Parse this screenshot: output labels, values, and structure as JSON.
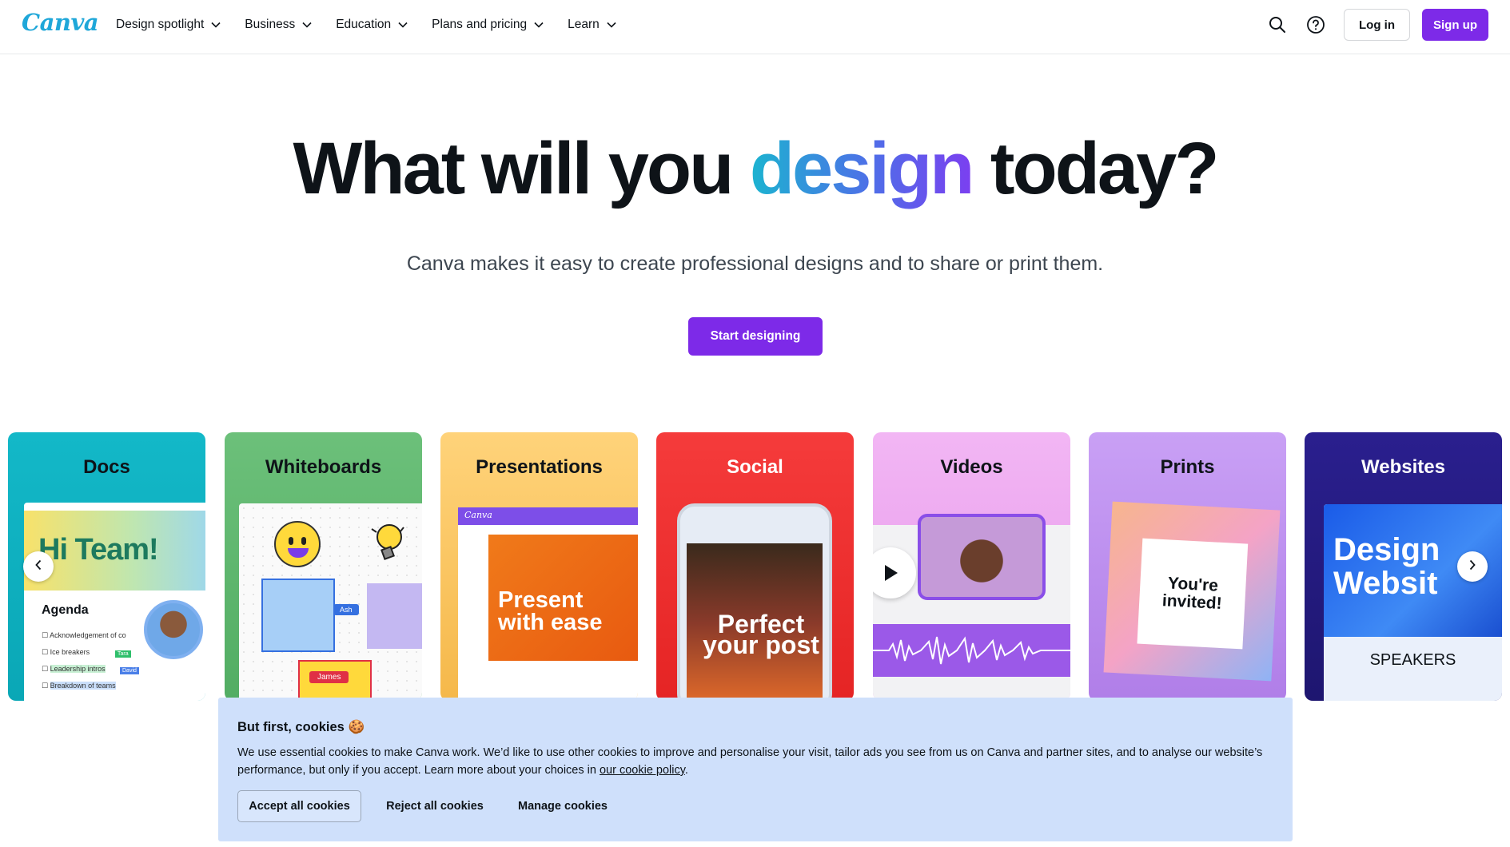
{
  "header": {
    "logo": "Canva",
    "nav": [
      {
        "label": "Design spotlight"
      },
      {
        "label": "Business"
      },
      {
        "label": "Education"
      },
      {
        "label": "Plans and pricing"
      },
      {
        "label": "Learn"
      }
    ],
    "icons": [
      "search-icon",
      "help-icon"
    ],
    "login_label": "Log in",
    "signup_label": "Sign up"
  },
  "hero": {
    "title_before": "What will you ",
    "title_accent": "design",
    "title_after": " today?",
    "subtitle": "Canva makes it easy to create professional designs and to share or print them.",
    "cta_label": "Start designing"
  },
  "cards": [
    {
      "title": "Docs",
      "preview": {
        "heading": "Hi Team!",
        "agenda_title": "Agenda",
        "items": [
          "Acknowledgement of co",
          "Ice breakers",
          "Leadership intros",
          "Breakdown of teams"
        ],
        "tags": [
          "Tara",
          "David"
        ]
      }
    },
    {
      "title": "Whiteboards",
      "preview": {
        "tags": [
          "Ash",
          "James"
        ]
      }
    },
    {
      "title": "Presentations",
      "preview": {
        "app_logo": "Canva",
        "text": "Present with ease"
      }
    },
    {
      "title": "Social",
      "preview": {
        "text": "Perfect your post"
      }
    },
    {
      "title": "Videos"
    },
    {
      "title": "Prints",
      "preview": {
        "text": "You're invited!"
      }
    },
    {
      "title": "Websites",
      "preview": {
        "text": "Design Websit",
        "speakers": "SPEAKERS"
      }
    }
  ],
  "carousel": {
    "prev_icon": "chevron-left-icon",
    "next_icon": "chevron-right-icon"
  },
  "cookie_banner": {
    "title": "But first, cookies 🍪",
    "body_text": "We use essential cookies to make Canva work. We’d like to use other cookies to improve and personalise your visit, tailor ads you see from us on Canva and partner sites, and to analyse our website’s performance, but only if you accept. Learn more about your choices in ",
    "link_text": "our cookie policy",
    "body_end": ".",
    "accept_label": "Accept all cookies",
    "reject_label": "Reject all cookies",
    "manage_label": "Manage cookies"
  },
  "colors": {
    "brand": "#7d2ae8",
    "logo": "#1fa7d9",
    "cookie_bg": "#cfe0fb"
  }
}
